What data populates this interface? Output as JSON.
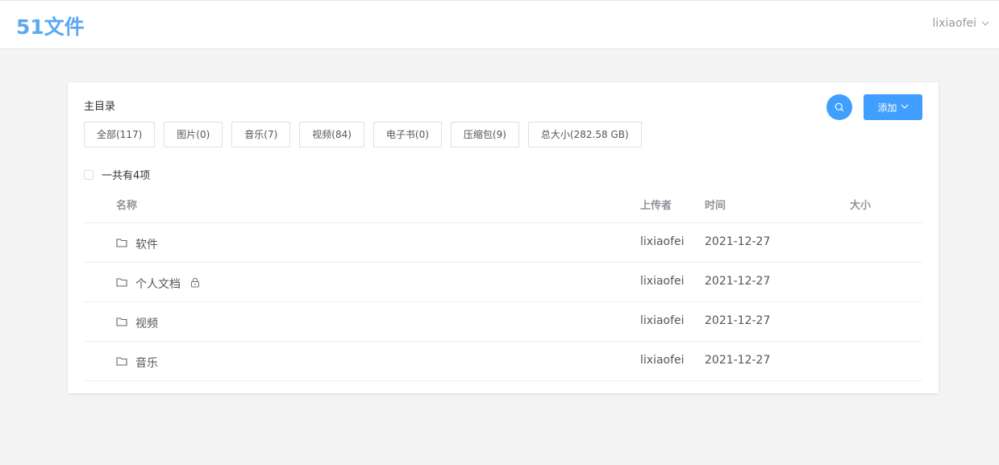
{
  "header": {
    "logo": "51文件",
    "username": "lixiaofei"
  },
  "toolbar": {
    "breadcrumb": "主目录",
    "add_label": "添加"
  },
  "filters": [
    {
      "label": "全部(117)"
    },
    {
      "label": "图片(0)"
    },
    {
      "label": "音乐(7)"
    },
    {
      "label": "视频(84)"
    },
    {
      "label": "电子书(0)"
    },
    {
      "label": "压缩包(9)"
    },
    {
      "label": "总大小(282.58 GB)"
    }
  ],
  "list": {
    "summary": "一共有4项",
    "columns": {
      "name": "名称",
      "uploader": "上传者",
      "time": "时间",
      "size": "大小"
    },
    "rows": [
      {
        "name": "软件",
        "uploader": "lixiaofei",
        "time": "2021-12-27",
        "size": "",
        "locked": false
      },
      {
        "name": "个人文档",
        "uploader": "lixiaofei",
        "time": "2021-12-27",
        "size": "",
        "locked": true
      },
      {
        "name": "视频",
        "uploader": "lixiaofei",
        "time": "2021-12-27",
        "size": "",
        "locked": false
      },
      {
        "name": "音乐",
        "uploader": "lixiaofei",
        "time": "2021-12-27",
        "size": "",
        "locked": false
      }
    ]
  },
  "icons": {
    "search": "search-icon",
    "chevron": "chevron-down-icon",
    "folder": "folder-icon",
    "lock": "lock-icon"
  },
  "colors": {
    "accent": "#409eff",
    "logo": "#5aa7f2"
  }
}
